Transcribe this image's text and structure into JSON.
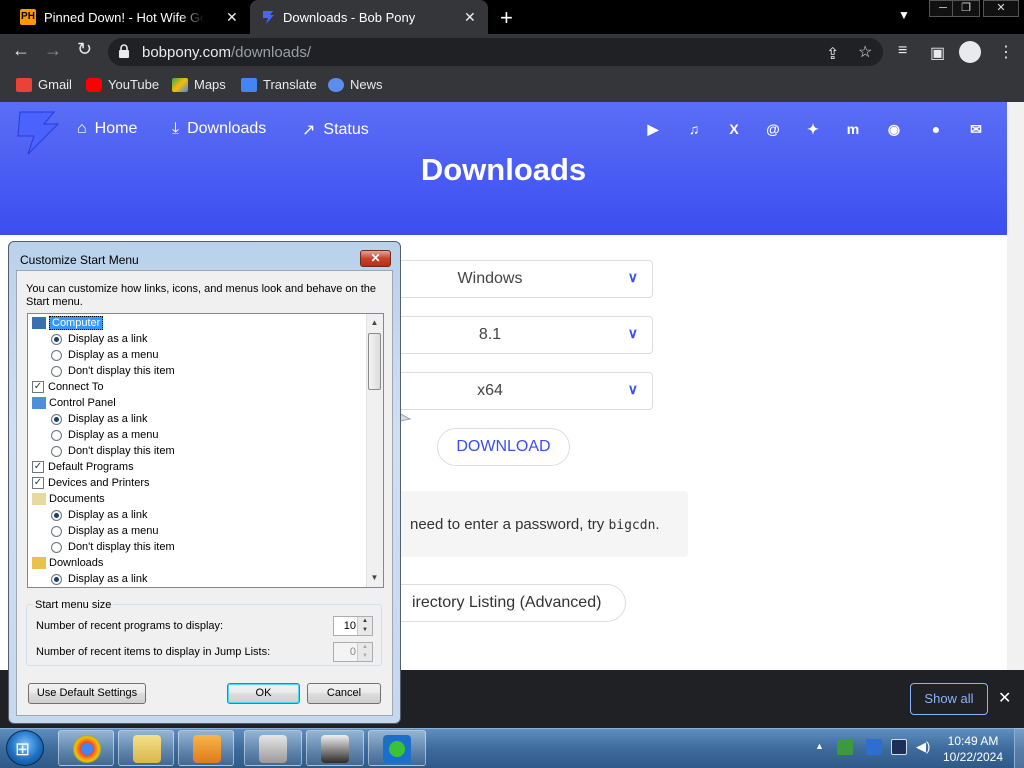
{
  "browser": {
    "tabs": [
      {
        "favicon": "ph-favicon-icon",
        "title": "Pinned Down! - Hot Wife Gets Pc",
        "close": "✕"
      },
      {
        "favicon": "bobpony-favicon-icon",
        "title": "Downloads - Bob Pony",
        "close": "✕"
      }
    ],
    "new_tab": "+",
    "url_host": "bobpony.com",
    "url_path": "/downloads/",
    "bookmarks": [
      {
        "label": "Gmail",
        "icon": "gmail-icon",
        "color": "#ea4335"
      },
      {
        "label": "YouTube",
        "icon": "youtube-icon",
        "color": "#ff0000"
      },
      {
        "label": "Maps",
        "icon": "maps-icon",
        "color": "#34a853"
      },
      {
        "label": "Translate",
        "icon": "translate-icon",
        "color": "#4285f4"
      },
      {
        "label": "News",
        "icon": "news-icon",
        "color": "#5a8dee"
      }
    ]
  },
  "site": {
    "nav": [
      {
        "label": "Home",
        "icon": "home-icon"
      },
      {
        "label": "Downloads",
        "icon": "download-icon"
      },
      {
        "label": "Status",
        "icon": "status-icon"
      }
    ],
    "title": "Downloads",
    "selects": [
      {
        "value": "Windows"
      },
      {
        "value": "8.1"
      },
      {
        "value": "x64"
      }
    ],
    "download_button": "DOWNLOAD",
    "notice_prefix": "need to enter a password, try ",
    "notice_code": "bigcdn",
    "notice_suffix": ".",
    "directory_button": "irectory Listing (Advanced)",
    "accent": "#3b4ef0"
  },
  "download_bar": {
    "show_all": "Show all",
    "close": "✕"
  },
  "dialog": {
    "title": "Customize Start Menu",
    "close": "✕",
    "description": "You can customize how links, icons, and menus look and behave on the Start menu.",
    "tree": [
      {
        "type": "node",
        "label": "Computer",
        "icon": "computer-icon",
        "selected": true
      },
      {
        "type": "radio",
        "label": "Display as a link",
        "checked": true
      },
      {
        "type": "radio",
        "label": "Display as a menu",
        "checked": false
      },
      {
        "type": "radio",
        "label": "Don't display this item",
        "checked": false
      },
      {
        "type": "check",
        "label": "Connect To",
        "checked": true
      },
      {
        "type": "node",
        "label": "Control Panel",
        "icon": "control-panel-icon",
        "selected": false
      },
      {
        "type": "radio",
        "label": "Display as a link",
        "checked": true
      },
      {
        "type": "radio",
        "label": "Display as a menu",
        "checked": false
      },
      {
        "type": "radio",
        "label": "Don't display this item",
        "checked": false
      },
      {
        "type": "check",
        "label": "Default Programs",
        "checked": true
      },
      {
        "type": "check",
        "label": "Devices and Printers",
        "checked": true
      },
      {
        "type": "node",
        "label": "Documents",
        "icon": "documents-icon",
        "selected": false
      },
      {
        "type": "radio",
        "label": "Display as a link",
        "checked": true
      },
      {
        "type": "radio",
        "label": "Display as a menu",
        "checked": false
      },
      {
        "type": "radio",
        "label": "Don't display this item",
        "checked": false
      },
      {
        "type": "node",
        "label": "Downloads",
        "icon": "downloads-folder-icon",
        "selected": false
      },
      {
        "type": "radio",
        "label": "Display as a link",
        "checked": true
      }
    ],
    "group_label": "Start menu size",
    "recent_programs_label": "Number of recent programs to display:",
    "recent_programs_value": "10",
    "jump_list_label": "Number of recent items to display in Jump Lists:",
    "jump_list_value": "0",
    "default_button": "Use Default Settings",
    "ok_button": "OK",
    "cancel_button": "Cancel"
  },
  "taskbar": {
    "apps": [
      {
        "name": "chrome-taskbar-icon"
      },
      {
        "name": "explorer-taskbar-icon"
      },
      {
        "name": "media-player-taskbar-icon"
      },
      {
        "name": "printer-taskbar-icon"
      },
      {
        "name": "archive-taskbar-icon"
      },
      {
        "name": "download-manager-taskbar-icon"
      }
    ],
    "time": "10:49 AM",
    "date": "10/22/2024"
  }
}
